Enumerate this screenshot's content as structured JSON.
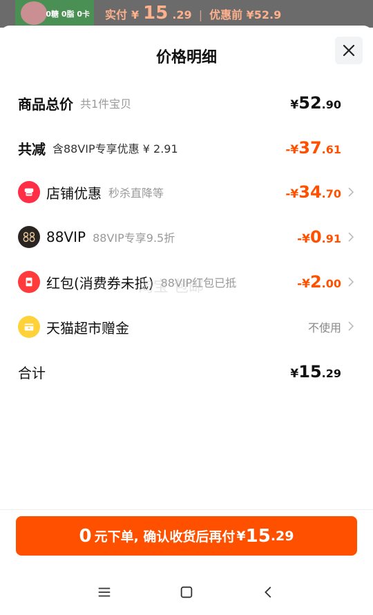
{
  "backdrop": {
    "thumb_text": "0糖 0脂 0卡",
    "price_prefix": "实付",
    "price_yen": "¥",
    "price_int": "15",
    "price_dec": ".29",
    "separator": "|",
    "original_label": "优惠前 ¥52.9"
  },
  "sheet": {
    "title": "价格明细"
  },
  "rows": {
    "total": {
      "label": "商品总价",
      "sub": "共1件宝贝",
      "yen": "¥",
      "int": "52",
      "dec": ".90"
    },
    "discount": {
      "label": "共减",
      "sub": "含88VIP专享优惠 ¥ 2.91",
      "yen": "-¥",
      "int": "37",
      "dec": ".61"
    },
    "shop": {
      "label": "店铺优惠",
      "sub": "秒杀直降等",
      "yen": "-¥",
      "int": "34",
      "dec": ".70"
    },
    "vip": {
      "label": "88VIP",
      "sub": "88VIP专享9.5折",
      "yen": "-¥",
      "int": "0",
      "dec": ".91"
    },
    "redpacket": {
      "label": "红包(消费券未抵)",
      "sub": "88VIP红包已抵",
      "yen": "-¥",
      "int": "2",
      "dec": ".00"
    },
    "gift": {
      "label": "天猫超市赠金",
      "right_text": "不使用"
    },
    "sum": {
      "label": "合计",
      "yen": "¥",
      "int": "15",
      "dec": ".29"
    }
  },
  "icons": {
    "shop": "store-icon",
    "vip": "88vip-icon",
    "redpacket": "red-packet-icon",
    "gift": "gift-card-icon"
  },
  "watermark": "淘宝 包邮",
  "cta": {
    "n0": "0",
    "text": "元下单, 确认收货后再付",
    "yen": "¥",
    "int": "15",
    "dec": ".29"
  },
  "colors": {
    "accent": "#ff5000",
    "shop_icon": "#ff2d46",
    "vip_icon": "#2b2522",
    "gift_icon": "#ffd23a"
  }
}
